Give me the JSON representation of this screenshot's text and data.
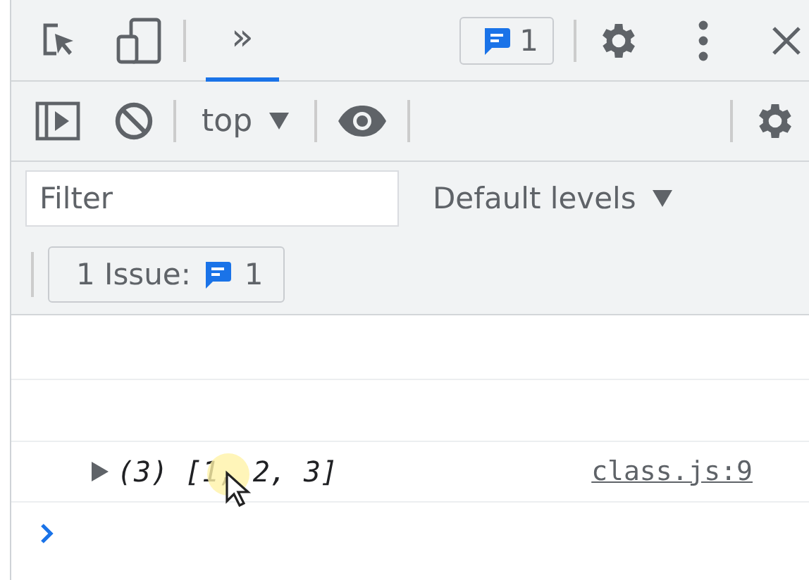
{
  "main_toolbar": {
    "tabs": [
      {
        "label": "»",
        "selected": true
      }
    ],
    "issues_count": "1"
  },
  "console_toolbar": {
    "context": "top"
  },
  "filter_bar": {
    "filter": {
      "placeholder": "Filter"
    },
    "levels": "Default levels"
  },
  "issues_bar": {
    "label": "1 Issue:",
    "count": "1"
  },
  "console": {
    "messages": [
      {
        "expanded": false,
        "summary": "(3) [1, 2, 3]",
        "source": "class.js:9"
      }
    ]
  }
}
